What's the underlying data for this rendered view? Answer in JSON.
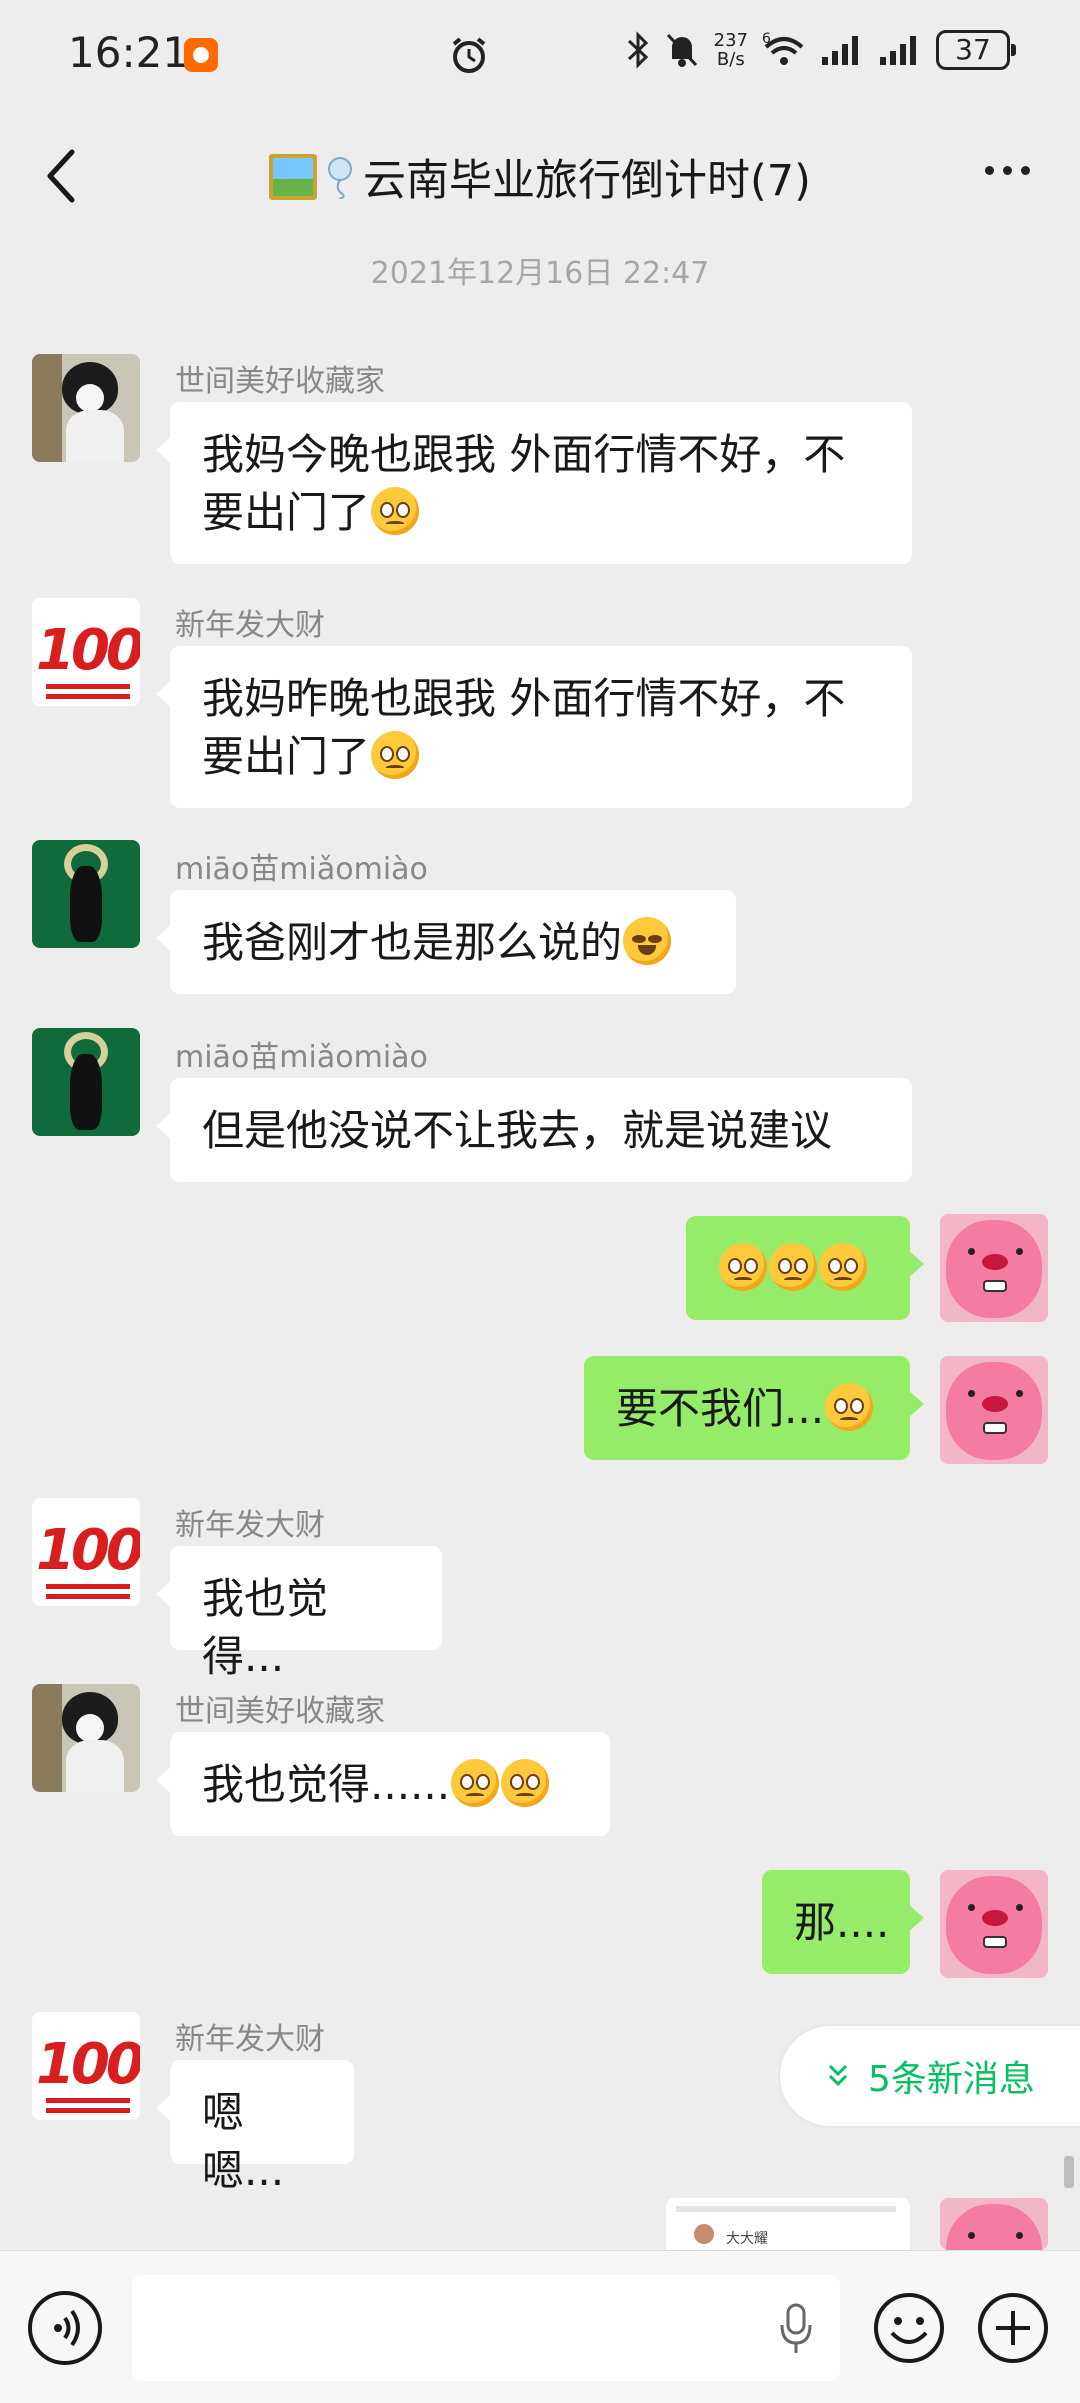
{
  "status_bar": {
    "time": "16:21",
    "net_speed_value": "237",
    "net_speed_unit": "B/s",
    "wifi_badge": "6",
    "battery": "37"
  },
  "nav": {
    "title": "云南毕业旅行倒计时(7)"
  },
  "timestamp": "2021年12月16日 22:47",
  "messages": [
    {
      "sender": "世间美好收藏家",
      "line1": "我妈今晚也跟我 外面行情不好，不",
      "line2": "要出门了"
    },
    {
      "sender": "新年发大财",
      "line1": "我妈昨晚也跟我 外面行情不好，不",
      "line2": "要出门了"
    },
    {
      "sender": "miāo苗miǎomiào",
      "text": "我爸刚才也是那么说的"
    },
    {
      "sender": "miāo苗miǎomiào",
      "text": "但是他没说不让我去，就是说建议"
    },
    {
      "sender": "",
      "text": ""
    },
    {
      "sender": "",
      "text": "要不我们..."
    },
    {
      "sender": "新年发大财",
      "text": "我也觉得..."
    },
    {
      "sender": "世间美好收藏家",
      "text": "我也觉得......"
    },
    {
      "sender": "",
      "text": "那...."
    },
    {
      "sender": "新年发大财",
      "text": "嗯嗯..."
    }
  ],
  "avatar_badge": "100",
  "new_messages": "5条新消息",
  "thumbnail_text": "大大耀",
  "icons": {
    "back": "chevron-left-icon",
    "more": "more-dots-icon",
    "voice": "voice-icon",
    "mic": "mic-icon",
    "emoji": "emoji-icon",
    "plus": "plus-icon"
  },
  "colors": {
    "outgoing_bubble": "#95ec69",
    "incoming_bubble": "#ffffff",
    "accent": "#07c160",
    "background": "#ededed"
  }
}
